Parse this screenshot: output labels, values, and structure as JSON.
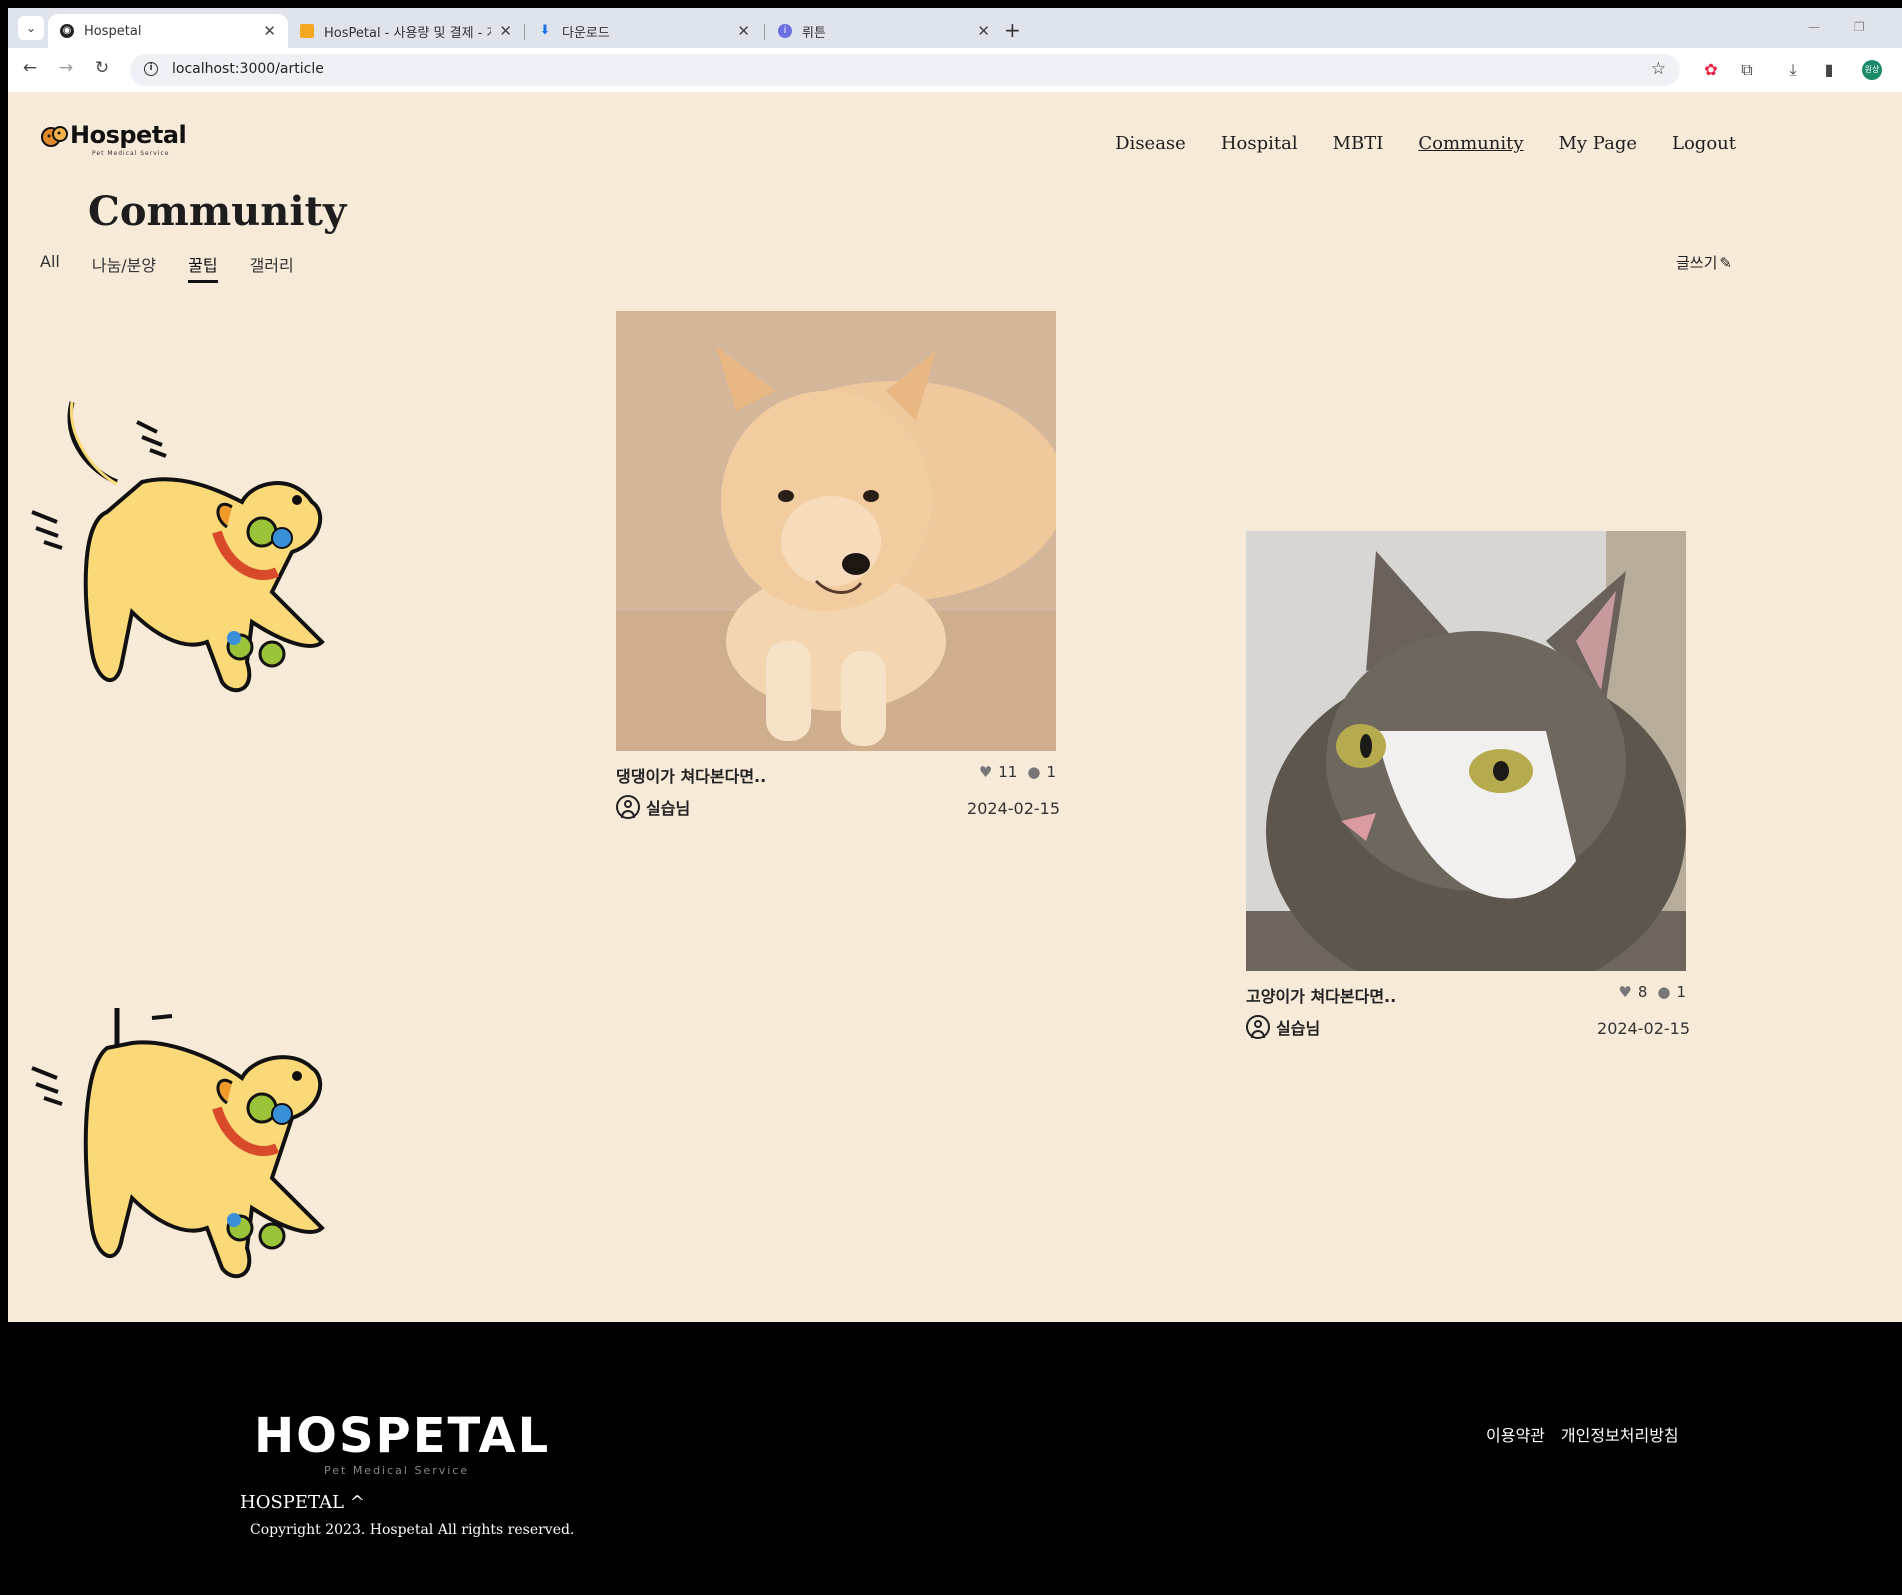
{
  "browser": {
    "tabs": [
      {
        "title": "Hospetal",
        "active": true
      },
      {
        "title": "HosPetal - 사용량 및 결제 - 개",
        "active": false
      },
      {
        "title": "다운로드",
        "active": false
      },
      {
        "title": "뤼튼",
        "active": false
      }
    ],
    "url": "localhost:3000/article",
    "profile_label": "원상"
  },
  "header": {
    "logo_text": "Hospetal",
    "logo_sub": "Pet Medical Service",
    "nav": [
      "Disease",
      "Hospital",
      "MBTI",
      "Community",
      "My Page",
      "Logout"
    ],
    "current_nav": "Community"
  },
  "main": {
    "title": "Community",
    "categories": [
      "All",
      "나눔/분양",
      "꿀팁",
      "갤러리"
    ],
    "current_category": "꿀팁",
    "write_label": "글쓰기"
  },
  "posts": [
    {
      "title": "댕댕이가 쳐다본다면..",
      "likes": "11",
      "comments": "1",
      "author": "실습님",
      "date": "2024-02-15"
    },
    {
      "title": "고양이가 쳐다본다면..",
      "likes": "8",
      "comments": "1",
      "author": "실습님",
      "date": "2024-02-15"
    }
  ],
  "footer": {
    "logo_text": "HOSPETAL",
    "logo_sub": "Pet Medical Service",
    "brand": "HOSPETAL ^",
    "copyright": "Copyright 2023. Hospetal All rights reserved.",
    "links": [
      "이용약관",
      "개인정보처리방침"
    ]
  },
  "colors": {
    "page_bg": "#f7ead9",
    "footer_bg": "#000000",
    "accent": "#111111"
  }
}
